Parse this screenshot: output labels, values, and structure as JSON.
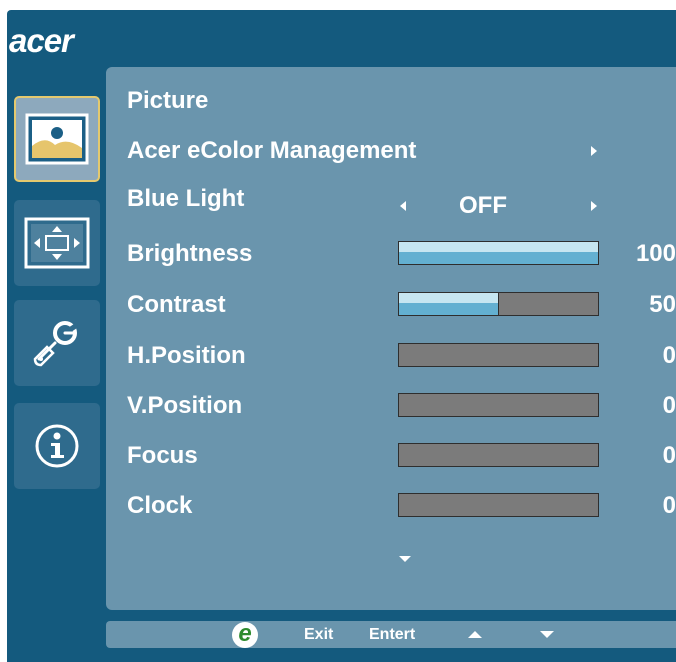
{
  "brand": {
    "logo_text": "acer"
  },
  "sidebar": {
    "items": [
      {
        "icon": "picture-icon",
        "active": true
      },
      {
        "icon": "display-position-icon",
        "active": false
      },
      {
        "icon": "settings-wrench-icon",
        "active": false
      },
      {
        "icon": "info-icon",
        "active": false
      }
    ]
  },
  "menu": {
    "title": "Picture",
    "ecolor_label": "Acer eColor Management",
    "blue_light": {
      "label": "Blue Light",
      "value": "OFF"
    },
    "sliders": [
      {
        "label": "Brightness",
        "value": "100",
        "fraction": 1.0
      },
      {
        "label": "Contrast",
        "value": "50",
        "fraction": 0.5
      },
      {
        "label": "H.Position",
        "value": "0",
        "fraction": 0
      },
      {
        "label": "V.Position",
        "value": "0",
        "fraction": 0
      },
      {
        "label": "Focus",
        "value": "0",
        "fraction": 0
      },
      {
        "label": "Clock",
        "value": "0",
        "fraction": 0
      }
    ]
  },
  "footer": {
    "e_label": "e",
    "exit_label": "Exit",
    "enter_label": "Entert"
  },
  "colors": {
    "frame": "#145a7e",
    "panel": "#6a95ad",
    "active_border": "#e4c96e",
    "fill_light": "#c6e6f1",
    "fill_dark": "#63b0d1"
  }
}
